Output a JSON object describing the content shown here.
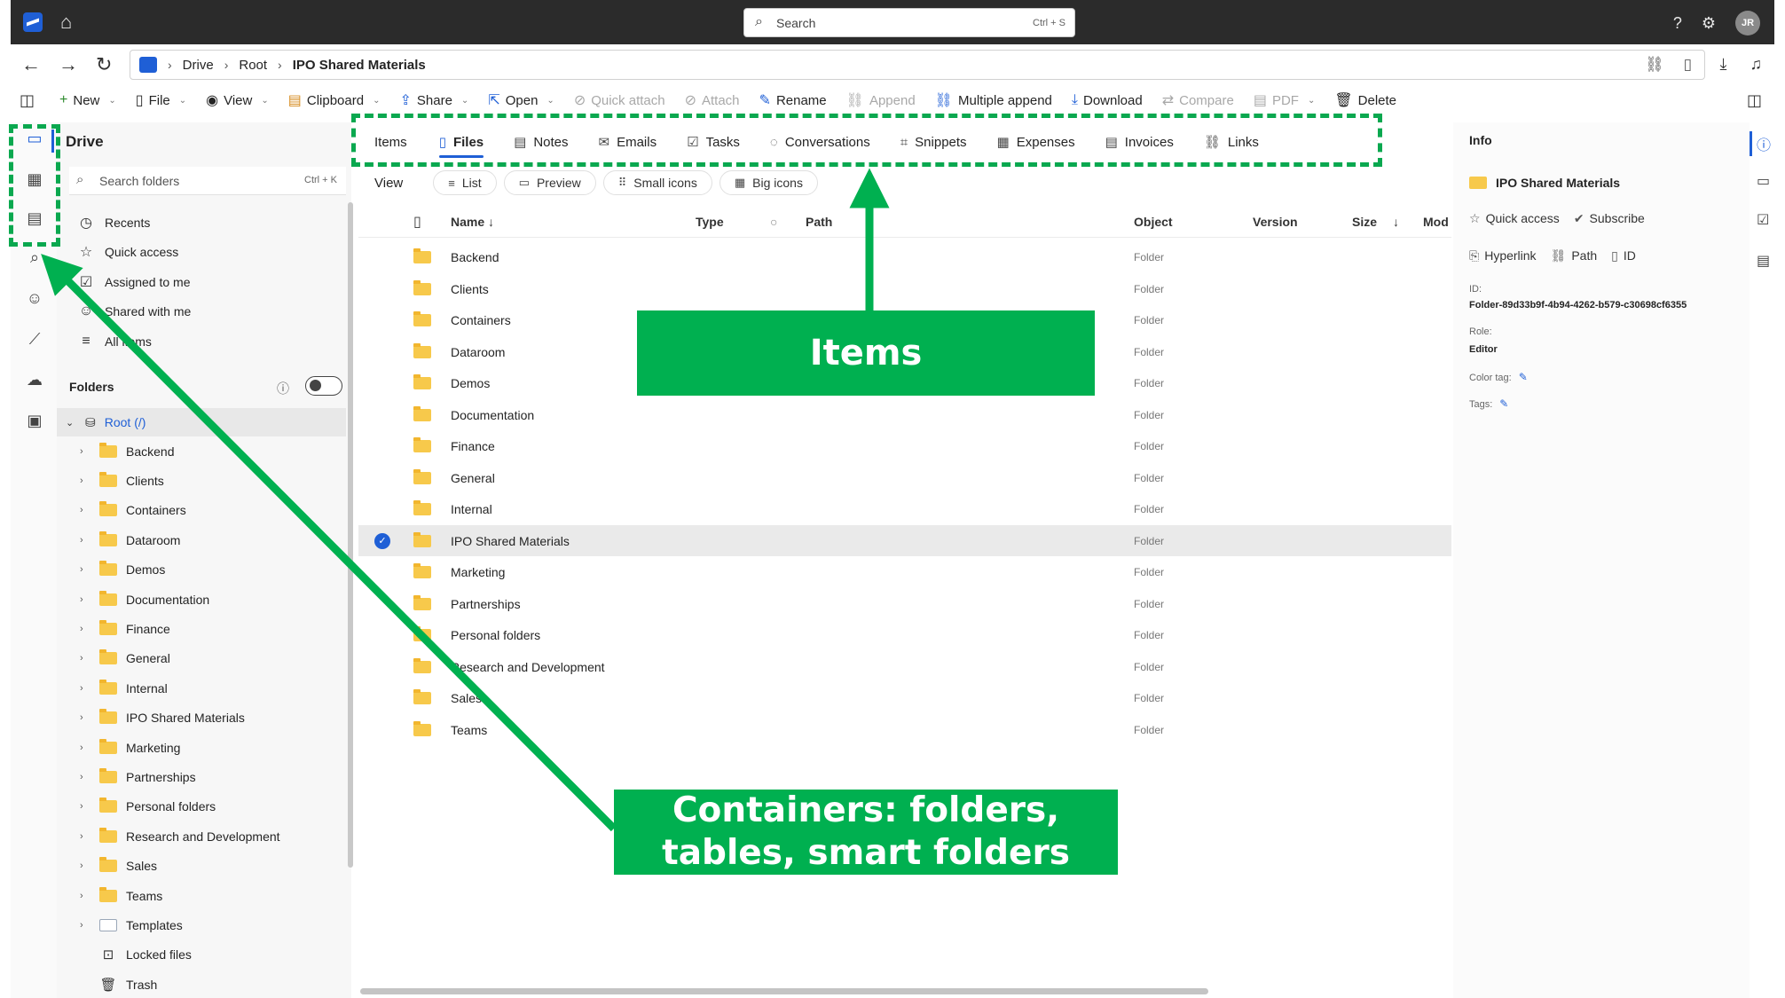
{
  "topbar": {
    "search_placeholder": "Search",
    "search_shortcut": "Ctrl + S",
    "avatar_initials": "JR"
  },
  "breadcrumb": [
    "Drive",
    "Root",
    "IPO Shared Materials"
  ],
  "commands": [
    {
      "label": "New",
      "icon": "plus-icon",
      "chevron": true,
      "disabled": false
    },
    {
      "label": "File",
      "icon": "file-icon",
      "chevron": true,
      "disabled": false
    },
    {
      "label": "View",
      "icon": "eye-icon",
      "chevron": true,
      "disabled": false
    },
    {
      "label": "Clipboard",
      "icon": "clipboard-icon",
      "chevron": true,
      "disabled": false
    },
    {
      "label": "Share",
      "icon": "share-icon",
      "chevron": true,
      "disabled": false
    },
    {
      "label": "Open",
      "icon": "open-icon",
      "chevron": true,
      "disabled": false
    },
    {
      "label": "Quick attach",
      "icon": "attach-icon",
      "chevron": false,
      "disabled": true
    },
    {
      "label": "Attach",
      "icon": "paperclip-icon",
      "chevron": false,
      "disabled": true
    },
    {
      "label": "Rename",
      "icon": "pencil-icon",
      "chevron": false,
      "disabled": false
    },
    {
      "label": "Append",
      "icon": "append-icon",
      "chevron": false,
      "disabled": true
    },
    {
      "label": "Multiple append",
      "icon": "multiple-append-icon",
      "chevron": false,
      "disabled": false
    },
    {
      "label": "Download",
      "icon": "download-icon",
      "chevron": false,
      "disabled": false
    },
    {
      "label": "Compare",
      "icon": "compare-icon",
      "chevron": false,
      "disabled": true
    },
    {
      "label": "PDF",
      "icon": "pdf-icon",
      "chevron": true,
      "disabled": true
    },
    {
      "label": "Delete",
      "icon": "trash-icon",
      "chevron": false,
      "disabled": false
    }
  ],
  "left_panel": {
    "title": "Drive",
    "search_placeholder": "Search folders",
    "search_shortcut": "Ctrl + K",
    "quick_links": [
      {
        "label": "Recents",
        "icon": "clock-icon"
      },
      {
        "label": "Quick access",
        "icon": "star-icon"
      },
      {
        "label": "Assigned to me",
        "icon": "assigned-icon"
      },
      {
        "label": "Shared with me",
        "icon": "people-icon"
      },
      {
        "label": "All items",
        "icon": "list-icon"
      }
    ],
    "folders_heading": "Folders",
    "root_label": "Root (/)",
    "tree": [
      "Backend",
      "Clients",
      "Containers",
      "Dataroom",
      "Demos",
      "Documentation",
      "Finance",
      "General",
      "Internal",
      "IPO Shared Materials",
      "Marketing",
      "Partnerships",
      "Personal folders",
      "Research and Development",
      "Sales",
      "Teams",
      "Templates"
    ],
    "special": [
      {
        "label": "Locked files",
        "icon": "lock-icon"
      },
      {
        "label": "Trash",
        "icon": "trash-icon"
      }
    ]
  },
  "tabs": [
    {
      "label": "Items",
      "icon": "",
      "active": false
    },
    {
      "label": "Files",
      "icon": "file-icon",
      "active": true
    },
    {
      "label": "Notes",
      "icon": "note-icon",
      "active": false
    },
    {
      "label": "Emails",
      "icon": "mail-icon",
      "active": false
    },
    {
      "label": "Tasks",
      "icon": "task-icon",
      "active": false
    },
    {
      "label": "Conversations",
      "icon": "chat-icon",
      "active": false
    },
    {
      "label": "Snippets",
      "icon": "snippet-icon",
      "active": false
    },
    {
      "label": "Expenses",
      "icon": "expense-icon",
      "active": false
    },
    {
      "label": "Invoices",
      "icon": "invoice-icon",
      "active": false
    },
    {
      "label": "Links",
      "icon": "link-icon",
      "active": false
    }
  ],
  "view": {
    "label": "View",
    "options": [
      {
        "label": "List",
        "icon": "list-icon"
      },
      {
        "label": "Preview",
        "icon": "preview-icon"
      },
      {
        "label": "Small icons",
        "icon": "small-icons-icon"
      },
      {
        "label": "Big icons",
        "icon": "big-icons-icon"
      }
    ]
  },
  "table": {
    "headers": {
      "name": "Name",
      "type": "Type",
      "path": "Path",
      "object": "Object",
      "version": "Version",
      "size": "Size",
      "modified": "Mod"
    },
    "rows": [
      {
        "name": "Backend",
        "object": "Folder",
        "selected": false
      },
      {
        "name": "Clients",
        "object": "Folder",
        "selected": false
      },
      {
        "name": "Containers",
        "object": "Folder",
        "selected": false
      },
      {
        "name": "Dataroom",
        "object": "Folder",
        "selected": false
      },
      {
        "name": "Demos",
        "object": "Folder",
        "selected": false
      },
      {
        "name": "Documentation",
        "object": "Folder",
        "selected": false
      },
      {
        "name": "Finance",
        "object": "Folder",
        "selected": false
      },
      {
        "name": "General",
        "object": "Folder",
        "selected": false
      },
      {
        "name": "Internal",
        "object": "Folder",
        "selected": false
      },
      {
        "name": "IPO Shared Materials",
        "object": "Folder",
        "selected": true
      },
      {
        "name": "Marketing",
        "object": "Folder",
        "selected": false
      },
      {
        "name": "Partnerships",
        "object": "Folder",
        "selected": false
      },
      {
        "name": "Personal folders",
        "object": "Folder",
        "selected": false
      },
      {
        "name": "Research and Development",
        "object": "Folder",
        "selected": false
      },
      {
        "name": "Sales",
        "object": "Folder",
        "selected": false
      },
      {
        "name": "Teams",
        "object": "Folder",
        "selected": false
      }
    ]
  },
  "info": {
    "title": "Info",
    "name": "IPO Shared Materials",
    "quick_access": "Quick access",
    "subscribe": "Subscribe",
    "hyperlink": "Hyperlink",
    "path": "Path",
    "id_button": "ID",
    "id_label": "ID:",
    "id_value": "Folder-89d33b9f-4b94-4262-b579-c30698cf6355",
    "role_label": "Role:",
    "role_value": "Editor",
    "color_tag_label": "Color tag:",
    "tags_label": "Tags:"
  },
  "annotations": {
    "items_callout": "Items",
    "containers_callout": [
      "Containers: folders,",
      "tables, smart folders"
    ],
    "color": "#00b050"
  }
}
